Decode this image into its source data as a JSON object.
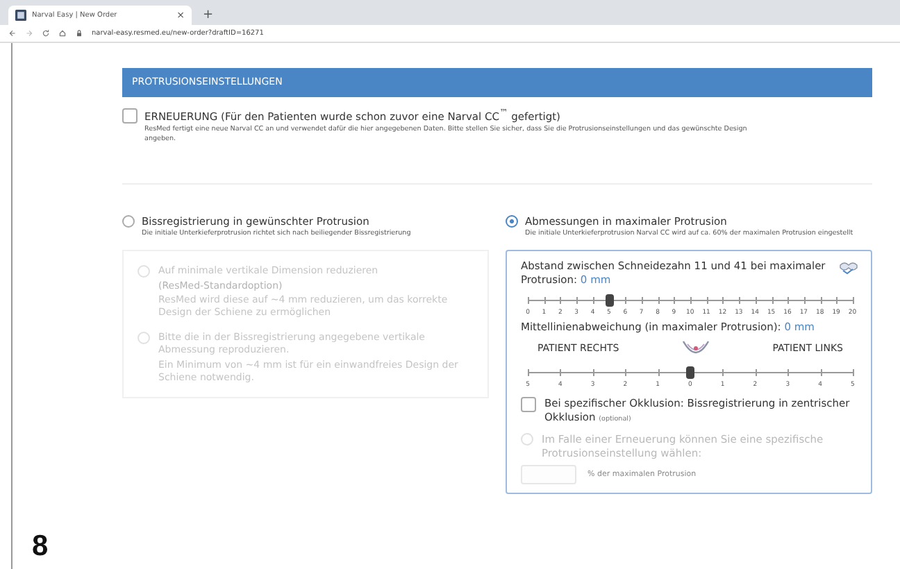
{
  "browser": {
    "tab": {
      "title": "Narval Easy | New Order",
      "close": "×"
    },
    "new_tab": "+",
    "url": "narval-easy.resmed.eu/new-order?draftID=16271"
  },
  "figure_number": "8",
  "section": {
    "title": "PROTRUSIONSEINSTELLUNGEN"
  },
  "renewal": {
    "label": "ERNEUERUNG (Für den Patienten wurde schon zuvor eine Narval CC$^{™}$ gefertigt)",
    "checked": false,
    "description": "ResMed fertigt eine neue Narval CC an und verwendet dafür die hier angegebenen Daten. Bitte stellen Sie sicher, dass Sie die Protrusionseinstellungen und das gewünschte Design angeben."
  },
  "methods": [
    {
      "label": "Bissregistrierung in gewünschter Protrusion",
      "selected": false,
      "description": "Die initiale Unterkieferprotrusion richtet sich nach beiliegender Bissregistrierung",
      "options": [
        {
          "lines": [
            "Auf minimale vertikale Dimension reduzieren",
            "(ResMed-Standardoption)",
            "ResMed wird diese auf ~4 mm reduzieren, um das korrekte Design der Schiene zu ermöglichen"
          ],
          "checked": false,
          "disabled": true
        },
        {
          "lines": [
            "Bitte die in der Bissregistrierung angegebene vertikale Abmessung reproduzieren.",
            "Ein Minimum von ~4 mm ist für ein einwandfreies Design der Schiene notwendig."
          ],
          "checked": false,
          "disabled": true
        }
      ]
    },
    {
      "label": "Abmessungen in maximaler Protrusion",
      "selected": true,
      "description": "Die initiale Unterkieferprotrusion Narval CC wird auf ca. 60% der maximalen Protrusion eingestellt",
      "panel": {
        "distance": {
          "label": "Abstand zwischen Schneidezahn 11 und 41 bei maximaler Protrusion:",
          "value": "0 mm",
          "level": 0.25,
          "ticks": [
            "0",
            "1",
            "2",
            "3",
            "4",
            "5",
            "6",
            "7",
            "8",
            "9",
            "10",
            "11",
            "12",
            "13",
            "14",
            "15",
            "16",
            "17",
            "18",
            "19",
            "20"
          ]
        },
        "midline": {
          "label": "Mittellinienabweichung (in maximaler Protrusion):",
          "value": "0 mm",
          "left": "PATIENT RECHTS",
          "right": "PATIENT LINKS",
          "level": 0.5,
          "ticks": [
            "5",
            "4",
            "3",
            "2",
            "1",
            "0",
            "1",
            "2",
            "3",
            "4",
            "5"
          ]
        },
        "occlusion": {
          "label": "Bei spezifischer Okklusion: Bissregistrierung in zentrischer Okklusion",
          "note": "(optional)",
          "checked": false
        },
        "renewal_option": {
          "label": "Im Falle einer Erneuerung können Sie eine spezifische Protrusionseinstellung wählen:",
          "checked": false,
          "disabled": true,
          "unit": "% der maximalen Protrusion"
        }
      }
    }
  ]
}
